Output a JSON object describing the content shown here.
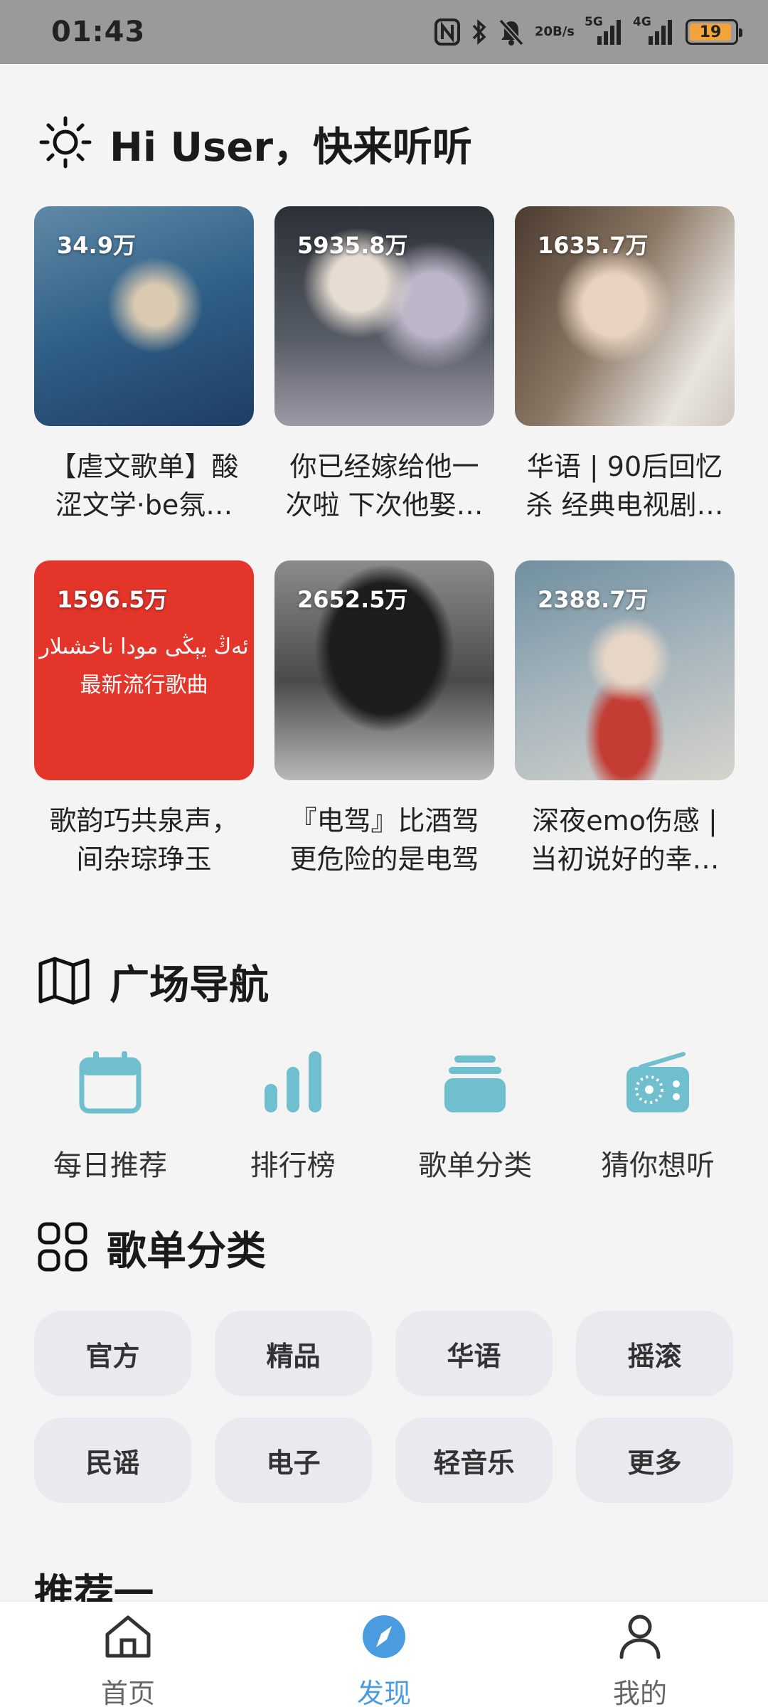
{
  "status_bar": {
    "time": "01:43",
    "net_speed_top": "20",
    "net_speed_bottom": "B/s",
    "signal1_label": "5G",
    "signal2_label": "4G",
    "battery": "19",
    "battery_color": "#f2a33a"
  },
  "greeting": {
    "title": "Hi User，快来听听",
    "icon": "sun-icon"
  },
  "playlists": [
    {
      "count": "34.9万",
      "title": "【虐文歌单】酸涩文学·be氛…"
    },
    {
      "count": "5935.8万",
      "title": "你已经嫁给他一次啦 下次他娶…"
    },
    {
      "count": "1635.7万",
      "title": "华语 | 90后回忆杀 经典电视剧…"
    },
    {
      "count": "1596.5万",
      "title": "歌韵巧共泉声，间杂琮琤玉",
      "cover_text_1": "ئەڭ يېڭى مودا ناخشىلار",
      "cover_text_2": "最新流行歌曲"
    },
    {
      "count": "2652.5万",
      "title": "『电驾』比酒驾更危险的是电驾"
    },
    {
      "count": "2388.7万",
      "title": "深夜emo伤感 | 当初说好的幸…"
    }
  ],
  "plaza": {
    "title": "广场导航",
    "icon": "map-icon",
    "accent": "#6fbfce",
    "items": [
      {
        "label": "每日推荐",
        "icon": "calendar-icon"
      },
      {
        "label": "排行榜",
        "icon": "bar-chart-icon"
      },
      {
        "label": "歌单分类",
        "icon": "stack-icon"
      },
      {
        "label": "猜你想听",
        "icon": "radio-icon"
      }
    ]
  },
  "categories": {
    "title": "歌单分类",
    "icon": "grid-icon",
    "items": [
      "官方",
      "精品",
      "华语",
      "摇滚",
      "民谣",
      "电子",
      "轻音乐",
      "更多"
    ]
  },
  "recommend": {
    "title": "推荐一"
  },
  "tabbar": {
    "active_color": "#4a9be0",
    "items": [
      {
        "label": "首页",
        "icon": "home-icon"
      },
      {
        "label": "发现",
        "icon": "compass-icon"
      },
      {
        "label": "我的",
        "icon": "person-icon"
      }
    ]
  }
}
